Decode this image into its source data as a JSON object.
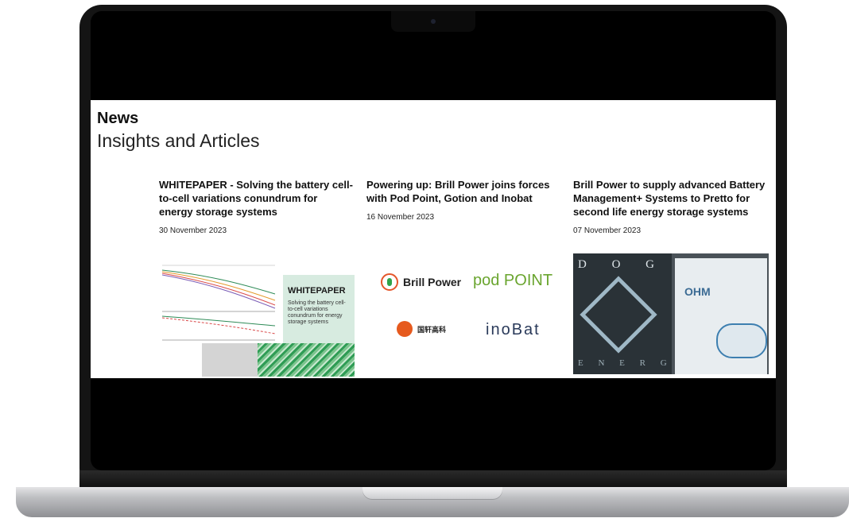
{
  "section": {
    "eyebrow": "News",
    "heading": "Insights and Articles"
  },
  "articles": [
    {
      "title": "WHITEPAPER - Solving the battery cell-to-cell variations conundrum for energy storage systems",
      "date": "30 November 2023",
      "image": {
        "badge": "WHITEPAPER",
        "caption": "Solving the battery cell-to-cell variations conundrum for energy storage systems"
      }
    },
    {
      "title": "Powering up: Brill Power joins forces with Pod Point, Gotion and Inobat",
      "date": "16 November 2023",
      "image": {
        "logos": [
          "Brill Power",
          "pod POINT",
          "国轩高科",
          "inoBat"
        ]
      }
    },
    {
      "title": "Brill Power to supply advanced Battery Management+ Systems to Pretto for second life energy storage systems",
      "date": "07 November 2023",
      "image": {
        "top": "D O G M A",
        "bottom": "E N E R G I A",
        "brand": "OHM"
      }
    }
  ],
  "colors": {
    "whitepaper_panel": "#d7ebe0",
    "pod_green": "#6aa52f",
    "brill_orange": "#e4562b"
  }
}
